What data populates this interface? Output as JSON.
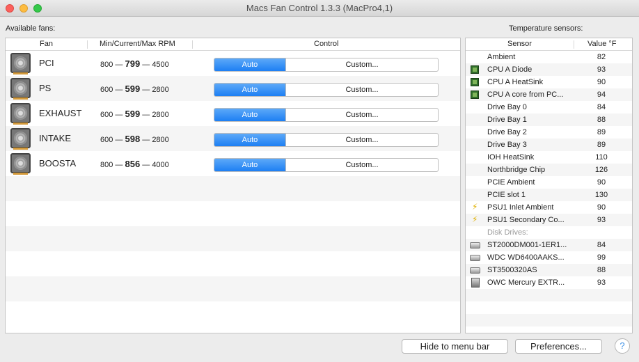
{
  "window": {
    "title": "Macs Fan Control 1.3.3 (MacPro4,1)"
  },
  "labels": {
    "available_fans": "Available fans:",
    "temperature_sensors": "Temperature sensors:"
  },
  "fans_table": {
    "headers": {
      "fan": "Fan",
      "rpm": "Min/Current/Max RPM",
      "control": "Control"
    },
    "rows": [
      {
        "name": "PCI",
        "min": "800",
        "current": "799",
        "max": "4500",
        "auto_label": "Auto",
        "custom_label": "Custom..."
      },
      {
        "name": "PS",
        "min": "600",
        "current": "599",
        "max": "2800",
        "auto_label": "Auto",
        "custom_label": "Custom..."
      },
      {
        "name": "EXHAUST",
        "min": "600",
        "current": "599",
        "max": "2800",
        "auto_label": "Auto",
        "custom_label": "Custom..."
      },
      {
        "name": "INTAKE",
        "min": "600",
        "current": "598",
        "max": "2800",
        "auto_label": "Auto",
        "custom_label": "Custom..."
      },
      {
        "name": "BOOSTA",
        "min": "800",
        "current": "856",
        "max": "4000",
        "auto_label": "Auto",
        "custom_label": "Custom..."
      }
    ]
  },
  "sensors_table": {
    "headers": {
      "sensor": "Sensor",
      "value": "Value °F"
    },
    "rows": [
      {
        "icon": "none",
        "name": "Ambient",
        "value": "82"
      },
      {
        "icon": "chip-icon",
        "name": "CPU A Diode",
        "value": "93"
      },
      {
        "icon": "chip-icon",
        "name": "CPU A HeatSink",
        "value": "90"
      },
      {
        "icon": "chip-icon",
        "name": "CPU A core from PC...",
        "value": "94"
      },
      {
        "icon": "none",
        "name": "Drive Bay 0",
        "value": "84"
      },
      {
        "icon": "none",
        "name": "Drive Bay 1",
        "value": "88"
      },
      {
        "icon": "none",
        "name": "Drive Bay 2",
        "value": "89"
      },
      {
        "icon": "none",
        "name": "Drive Bay 3",
        "value": "89"
      },
      {
        "icon": "none",
        "name": "IOH HeatSink",
        "value": "110"
      },
      {
        "icon": "none",
        "name": "Northbridge Chip",
        "value": "126"
      },
      {
        "icon": "none",
        "name": "PCIE Ambient",
        "value": "90"
      },
      {
        "icon": "none",
        "name": "PCIE slot 1",
        "value": "130"
      },
      {
        "icon": "bolt-icon",
        "name": "PSU1 Inlet Ambient",
        "value": "90"
      },
      {
        "icon": "bolt-icon",
        "name": "PSU1 Secondary Co...",
        "value": "93"
      },
      {
        "icon": "group",
        "name": "Disk Drives:",
        "value": ""
      },
      {
        "icon": "disk-icon",
        "name": "ST2000DM001-1ER1...",
        "value": "84"
      },
      {
        "icon": "disk-icon",
        "name": "WDC WD6400AAKS...",
        "value": "99"
      },
      {
        "icon": "disk-icon",
        "name": "ST3500320AS",
        "value": "88"
      },
      {
        "icon": "box-icon",
        "name": "OWC Mercury EXTR...",
        "value": "93"
      }
    ]
  },
  "buttons": {
    "hide": "Hide to menu bar",
    "preferences": "Preferences...",
    "help": "?"
  }
}
